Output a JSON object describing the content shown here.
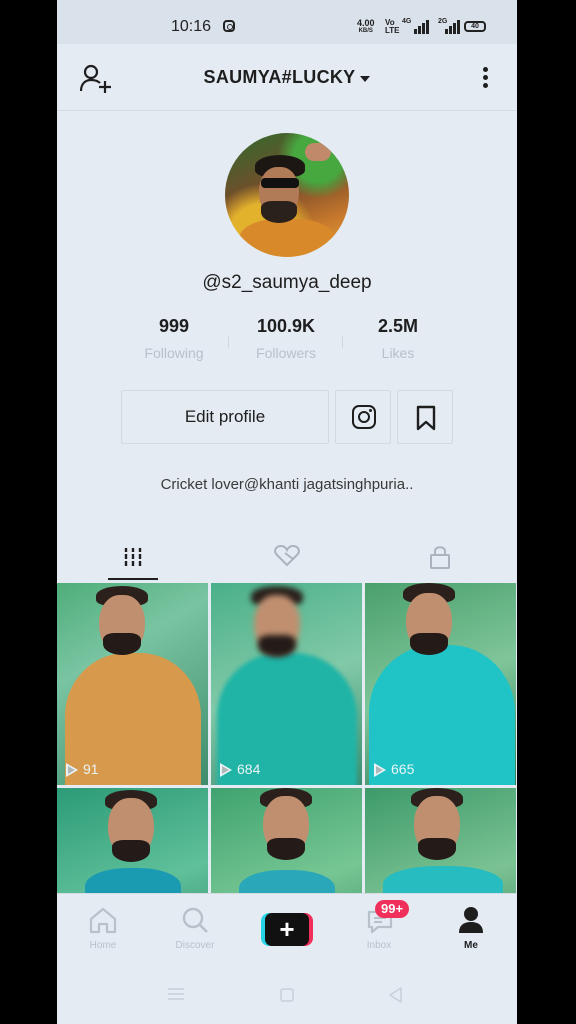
{
  "status": {
    "time": "10:16",
    "speed_top": "4.00",
    "speed_bottom": "KB/S",
    "volte_top": "Vo",
    "volte_bottom": "LTE",
    "net1": "4G",
    "net2": "2G",
    "battery": "40"
  },
  "header": {
    "title": "SAUMYA#LUCKY"
  },
  "profile": {
    "username": "@s2_saumya_deep",
    "stats": [
      {
        "value": "999",
        "label": "Following"
      },
      {
        "value": "100.9K",
        "label": "Followers"
      },
      {
        "value": "2.5M",
        "label": "Likes"
      }
    ],
    "edit_label": "Edit profile",
    "bio": "Cricket lover@khanti jagatsinghpuria.."
  },
  "videos": [
    {
      "views": "91"
    },
    {
      "views": "684"
    },
    {
      "views": "665"
    }
  ],
  "nav": {
    "items": [
      {
        "label": "Home"
      },
      {
        "label": "Discover"
      },
      {
        "label": "Inbox"
      },
      {
        "label": "Me"
      }
    ],
    "plus": "+",
    "inbox_badge": "99+"
  },
  "colors": {
    "background": "#e4ebf3",
    "accent_cyan": "#26d4e6",
    "accent_red": "#f0305b"
  }
}
